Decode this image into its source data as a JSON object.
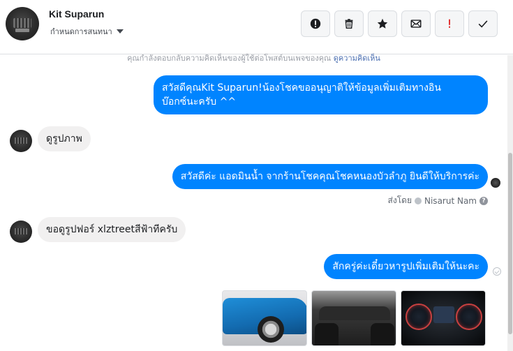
{
  "header": {
    "contact_name": "Kit Suparun",
    "manage_label": "กำหนดการสนทนา",
    "actions": [
      {
        "name": "report-icon",
        "color": "#1c1e21"
      },
      {
        "name": "trash-icon",
        "color": "#1c1e21"
      },
      {
        "name": "star-icon",
        "color": "#1c1e21"
      },
      {
        "name": "mail-icon",
        "color": "#1c1e21"
      },
      {
        "name": "exclamation-icon",
        "color": "#e02020"
      },
      {
        "name": "check-icon",
        "color": "#1c1e21"
      }
    ]
  },
  "notice": {
    "text": "คุณกำลังตอบกลับความคิดเห็นของผู้ใช้ต่อโพสต์บนเพจของคุณ",
    "link": "ดูความคิดเห็น"
  },
  "messages": [
    {
      "dir": "out",
      "lines": [
        "สวัสดีคุณKit Suparun!น้องโชคขออนุญาติให้ข้อมูลเพิ่มเติมทางอิน",
        "บ๊อกซ์นะครับ ^^"
      ]
    },
    {
      "dir": "in",
      "text": "ดูรูปภาพ"
    },
    {
      "dir": "out",
      "text": "สวัสดีค่ะ แอดมินน้ำ จากร้านโชคคุณโชคหนองบัวลำภู ยินดีให้บริการค่ะ"
    },
    {
      "dir": "in",
      "text": "ขอดูรูปฟอร์ xlztreetสีฟ้าทีครับ"
    },
    {
      "dir": "out",
      "text": "สักครู่ค่ะเดี๋ยวหารูปเพิ่มเติมให้นะคะ"
    }
  ],
  "sent_by": {
    "label": "ส่งโดย",
    "name": "Nisarut Nam",
    "help": "?"
  },
  "colors": {
    "outgoing_bubble": "#0084ff",
    "incoming_bubble": "#f1f0f0"
  }
}
